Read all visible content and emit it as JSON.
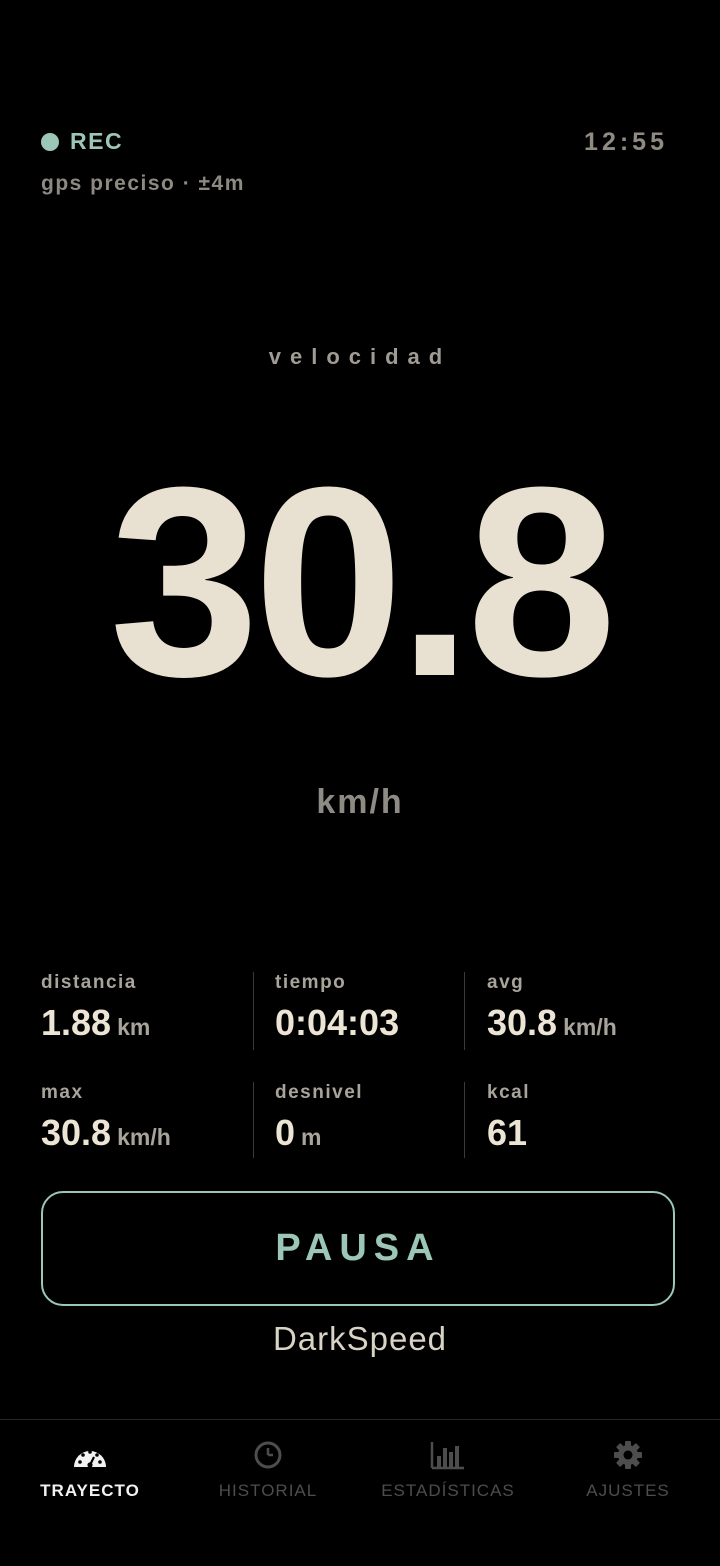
{
  "status": {
    "rec_label": "REC",
    "clock": "12:55",
    "gps": "gps preciso · ±4m"
  },
  "speed": {
    "label": "velocidad",
    "value": "30.8",
    "unit": "km/h"
  },
  "stats": [
    {
      "label": "distancia",
      "value": "1.88",
      "unit": "km"
    },
    {
      "label": "tiempo",
      "value": "0:04:03",
      "unit": ""
    },
    {
      "label": "avg",
      "value": "30.8",
      "unit": "km/h"
    },
    {
      "label": "max",
      "value": "30.8",
      "unit": "km/h"
    },
    {
      "label": "desnivel",
      "value": "0",
      "unit": "m"
    },
    {
      "label": "kcal",
      "value": "61",
      "unit": ""
    }
  ],
  "pause_button": "PAUSA",
  "app_name": "DarkSpeed",
  "tabs": [
    {
      "label": "TRAYECTO",
      "icon": "speedometer-icon",
      "active": true
    },
    {
      "label": "HISTORIAL",
      "icon": "clock-icon",
      "active": false
    },
    {
      "label": "ESTADÍSTICAS",
      "icon": "bar-chart-icon",
      "active": false
    },
    {
      "label": "AJUSTES",
      "icon": "gear-icon",
      "active": false
    }
  ],
  "colors": {
    "background": "#000000",
    "accent": "#9cc7b6",
    "primary_text": "#e8e0d0",
    "muted_text": "#8e8b84",
    "inactive_tab": "#4d4d4d"
  }
}
